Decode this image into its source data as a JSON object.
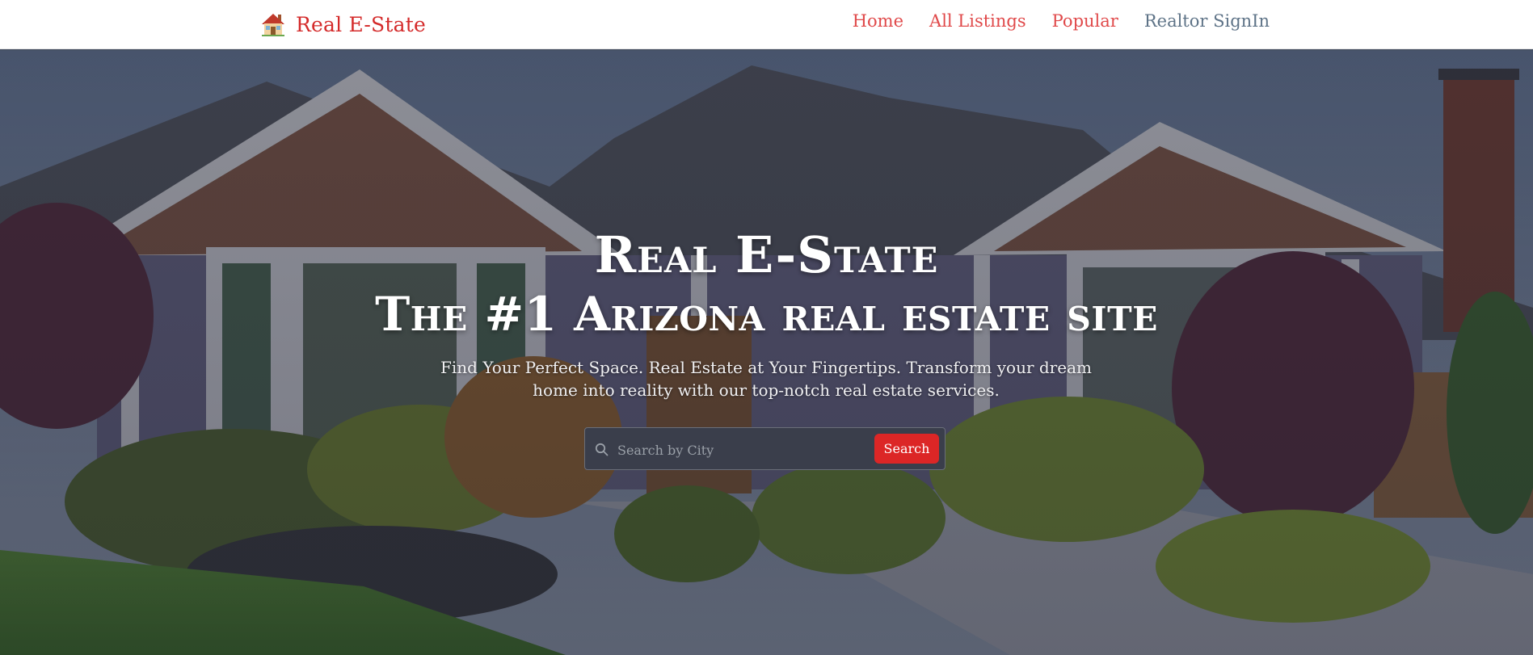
{
  "brand": {
    "icon": "house-icon",
    "name": "Real E-State"
  },
  "nav": {
    "items": [
      {
        "label": "Home"
      },
      {
        "label": "All Listings"
      },
      {
        "label": "Popular"
      },
      {
        "label": "Realtor SignIn"
      }
    ]
  },
  "hero": {
    "title_line1": "Real E-State",
    "title_line2": "The #1 Arizona real estate site",
    "subtitle": "Find Your Perfect Space. Real Estate at Your Fingertips. Transform your dream home into reality with our top-notch real estate services.",
    "search": {
      "placeholder": "Search by City",
      "button_label": "Search",
      "icon": "search-icon"
    }
  },
  "colors": {
    "brand_red": "#d42a2a",
    "nav_link": "#e0494a",
    "nav_link_muted": "#5e7387",
    "search_button": "#dc2626"
  }
}
